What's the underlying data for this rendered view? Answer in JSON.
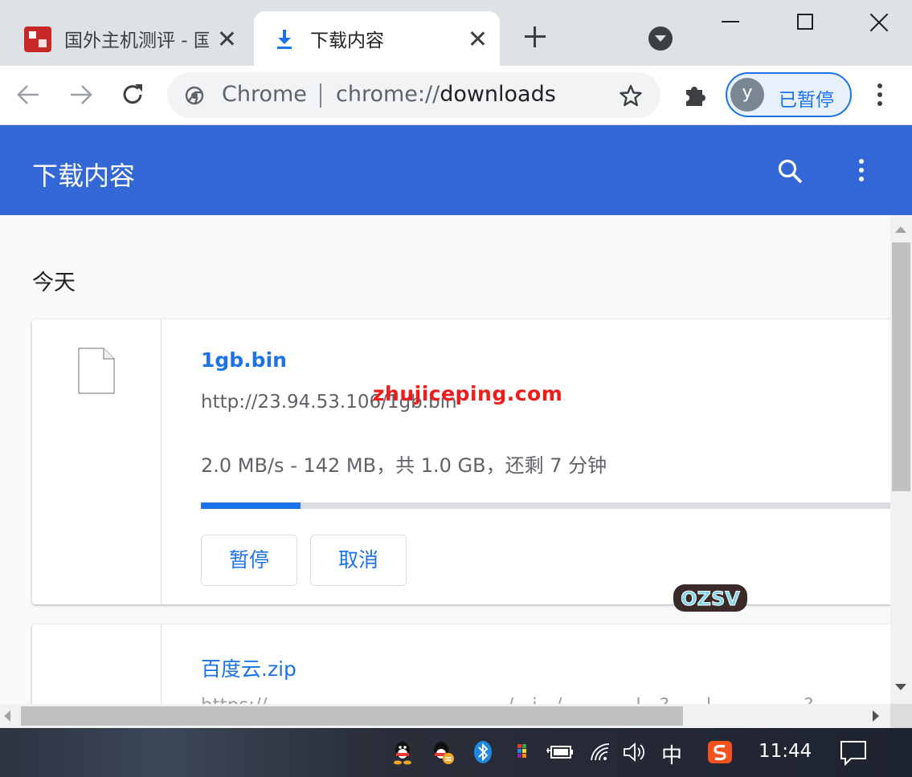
{
  "tabs": [
    {
      "title": "国外主机测评 - 国",
      "active": false
    },
    {
      "title": "下载内容",
      "active": true
    }
  ],
  "omnibox": {
    "site_chip": "Chrome",
    "url_scheme": "chrome://",
    "url_host": "downloads"
  },
  "profile": {
    "initial": "y",
    "status": "已暂停"
  },
  "page": {
    "title": "下载内容",
    "section_date": "今天"
  },
  "downloads": [
    {
      "file_name": "1gb.bin",
      "url": "http://23.94.53.106/1gb.bin",
      "status": "2.0 MB/s - 142 MB，共 1.0 GB，还剩 7 分钟",
      "progress": 0.142,
      "pause_label": "暂停",
      "cancel_label": "取消"
    },
    {
      "file_name": "百度云.zip",
      "url": "https://…………………………………/…i…/…………l…?……l……………?…"
    }
  ],
  "watermark": {
    "text": "zhujiceping.com",
    "sticker_text": "OZSV"
  },
  "taskbar": {
    "ime": "中",
    "time": "11:44"
  },
  "colors": {
    "header_blue": "#3367d6",
    "link_blue": "#1a73e8",
    "watermark_red": "#ef1c1c"
  },
  "icons": [
    "download-icon",
    "close-icon",
    "plus-icon",
    "tab-search-icon",
    "back-arrow-icon",
    "forward-arrow-icon",
    "reload-icon",
    "chrome-logo-icon",
    "star-icon",
    "puzzle-icon",
    "kebab-menu-icon",
    "search-icon",
    "file-icon",
    "qq-icon",
    "bluetooth-icon",
    "battery-icon",
    "wifi-icon",
    "volume-icon",
    "sogou-icon",
    "notification-icon"
  ]
}
